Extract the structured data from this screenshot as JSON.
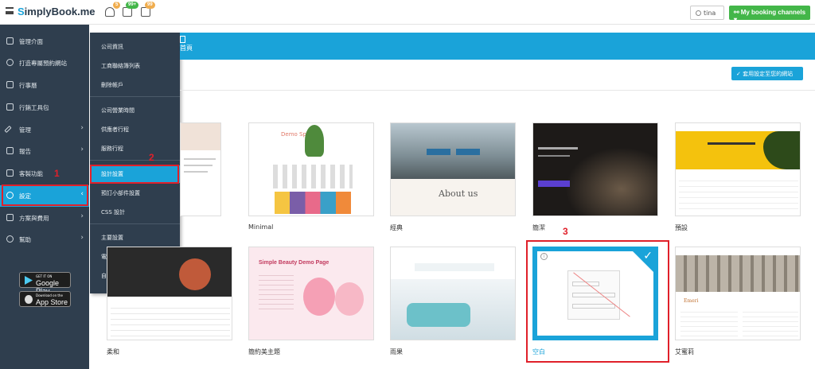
{
  "header": {
    "logo_prefix": "S",
    "logo_text": "implyBook.me",
    "badge1": "5",
    "badge2": "99+",
    "badge3": "99",
    "user": "tina",
    "booking_btn": "My booking channels"
  },
  "sidebar": {
    "items": [
      {
        "label": "管理介面",
        "icon": "dashboard-icon",
        "active": false
      },
      {
        "label": "打造專屬預約網站",
        "icon": "lightbulb-icon",
        "active": false
      },
      {
        "label": "行事曆",
        "icon": "calendar-icon",
        "active": false
      },
      {
        "label": "行銷工具包",
        "icon": "megaphone-icon",
        "active": false
      },
      {
        "label": "管理",
        "icon": "pencil-icon",
        "active": false
      },
      {
        "label": "報告",
        "icon": "chart-icon",
        "active": false
      },
      {
        "label": "客製功能",
        "icon": "gift-icon",
        "active": false
      },
      {
        "label": "設定",
        "icon": "gear-icon",
        "active": true
      },
      {
        "label": "方案與費用",
        "icon": "card-icon",
        "active": false
      },
      {
        "label": "幫助",
        "icon": "chat-icon",
        "active": false
      }
    ],
    "store1_small": "GET IT ON",
    "store1_big": "Google Play",
    "store2_small": "Download on the",
    "store2_big": "App Store"
  },
  "submenu": {
    "items": [
      "公司資訊",
      "工商聯絡簿列表",
      "刪除帳戶",
      "公司營業時間",
      "供應者行程",
      "服務行程",
      "設計設置",
      "預訂小部件設置",
      "CSS 設計",
      "主要設置",
      "電子郵件及 SMS 簡訊設定",
      "自訂文案＆翻譯"
    ]
  },
  "banner": {
    "text": "首頁"
  },
  "main": {
    "apply_btn": "✓ 套用設定至您的網站"
  },
  "themes": {
    "row1": [
      "",
      "Minimal",
      "經典",
      "簡潔",
      "預設"
    ],
    "row2": [
      "柔和",
      "簡約美主題",
      "雨果",
      "空白",
      "艾蜜莉"
    ]
  },
  "annotations": [
    "1",
    "2",
    "3"
  ],
  "colors": {
    "accent": "#1aa3d9",
    "sidebar": "#2f3e4e",
    "green": "#43b649",
    "red": "#e0202a"
  }
}
